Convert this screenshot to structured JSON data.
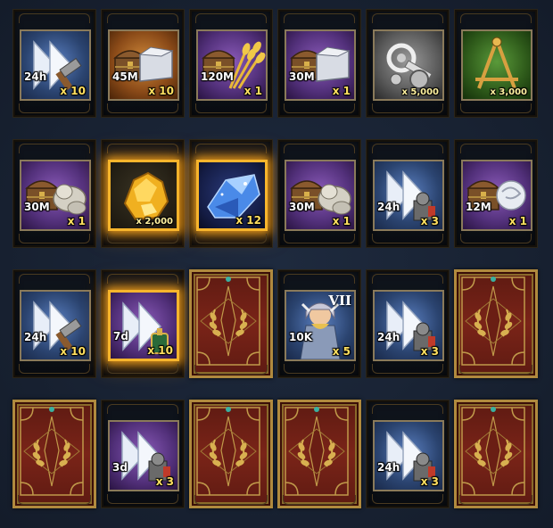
{
  "colors": {
    "highlight_border": "#f7b52c",
    "quantity_text": "#ffe060",
    "card_red": "#7a2418",
    "card_gold": "#b08a3e"
  },
  "rows": [
    [
      {
        "type": "item",
        "icon": "speedup-hammer-icon",
        "bg": "blue",
        "top_label": "24h",
        "qty": "x 10"
      },
      {
        "type": "item",
        "icon": "chest-iron-icon",
        "bg": "orange",
        "top_label": "45M",
        "qty": "x 10"
      },
      {
        "type": "item",
        "icon": "chest-wheat-icon",
        "bg": "purple",
        "top_label": "120M",
        "qty": "x 1"
      },
      {
        "type": "item",
        "icon": "chest-iron-icon",
        "bg": "purple",
        "top_label": "30M",
        "qty": "x 1"
      },
      {
        "type": "item",
        "icon": "gear-parts-icon",
        "bg": "gray",
        "top_label": "",
        "qty": "x 5,000"
      },
      {
        "type": "item",
        "icon": "compass-square-icon",
        "bg": "green",
        "top_label": "",
        "qty": "x 3,000"
      }
    ],
    [
      {
        "type": "item",
        "icon": "chest-stone-icon",
        "bg": "purple",
        "top_label": "30M",
        "qty": "x 1"
      },
      {
        "type": "item",
        "icon": "gold-ore-icon",
        "bg": "dark",
        "top_label": "",
        "qty": "x 2,000",
        "glow": true
      },
      {
        "type": "item",
        "icon": "blue-crystal-icon",
        "bg": "crystal",
        "top_label": "",
        "qty": "x 12",
        "glow": true
      },
      {
        "type": "item",
        "icon": "chest-stone-icon",
        "bg": "purple",
        "top_label": "30M",
        "qty": "x 1"
      },
      {
        "type": "item",
        "icon": "speedup-soldier-icon",
        "bg": "blue",
        "top_label": "24h",
        "qty": "x 3"
      },
      {
        "type": "item",
        "icon": "chest-silver-icon",
        "bg": "purple",
        "top_label": "12M",
        "qty": "x 1"
      }
    ],
    [
      {
        "type": "item",
        "icon": "speedup-hammer-icon",
        "bg": "blue",
        "top_label": "24h",
        "qty": "x 10"
      },
      {
        "type": "item",
        "icon": "speedup-potion-icon",
        "bg": "purple",
        "top_label": "7d",
        "qty": "x 10",
        "glow": true
      },
      {
        "type": "card"
      },
      {
        "type": "item",
        "icon": "hero-valkyrie-icon",
        "bg": "blue",
        "top_label": "10K",
        "qty": "x 5",
        "rank": "VII"
      },
      {
        "type": "item",
        "icon": "speedup-soldier-icon",
        "bg": "blue",
        "top_label": "24h",
        "qty": "x 3"
      },
      {
        "type": "card"
      }
    ],
    [
      {
        "type": "card"
      },
      {
        "type": "item",
        "icon": "speedup-soldier-icon",
        "bg": "purple",
        "top_label": "3d",
        "qty": "x 3"
      },
      {
        "type": "card"
      },
      {
        "type": "card"
      },
      {
        "type": "item",
        "icon": "speedup-soldier-icon",
        "bg": "blue",
        "top_label": "24h",
        "qty": "x 3"
      },
      {
        "type": "card"
      }
    ]
  ]
}
